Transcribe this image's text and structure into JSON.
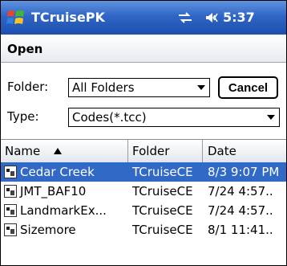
{
  "titlebar": {
    "app_title": "TCruisePK",
    "time": "5:37",
    "icons": [
      "windows-start-icon",
      "connectivity-icon",
      "volume-icon"
    ]
  },
  "header": {
    "title": "Open"
  },
  "folder": {
    "label": "Folder:",
    "value": "All Folders"
  },
  "type": {
    "label": "Type:",
    "value": "Codes(*.tcc)"
  },
  "cancel_label": "Cancel",
  "list": {
    "columns": [
      "Name",
      "Folder",
      "Date"
    ],
    "sort_column": "Name",
    "sort_direction": "ascending",
    "rows": [
      {
        "name": "Cedar Creek",
        "folder": "TCruiseCE",
        "date": "8/3 9:07 PM",
        "selected": true
      },
      {
        "name": "JMT_BAF10",
        "folder": "TCruiseCE",
        "date": "7/24 4:57..",
        "selected": false
      },
      {
        "name": "LandmarkEx...",
        "folder": "TCruiseCE",
        "date": "7/24 4:57..",
        "selected": false
      },
      {
        "name": "Sizemore",
        "folder": "TCruiseCE",
        "date": "8/1 11:41..",
        "selected": false
      }
    ]
  },
  "colors": {
    "titlebar": "#2f66c6",
    "selection": "#3169c6"
  }
}
